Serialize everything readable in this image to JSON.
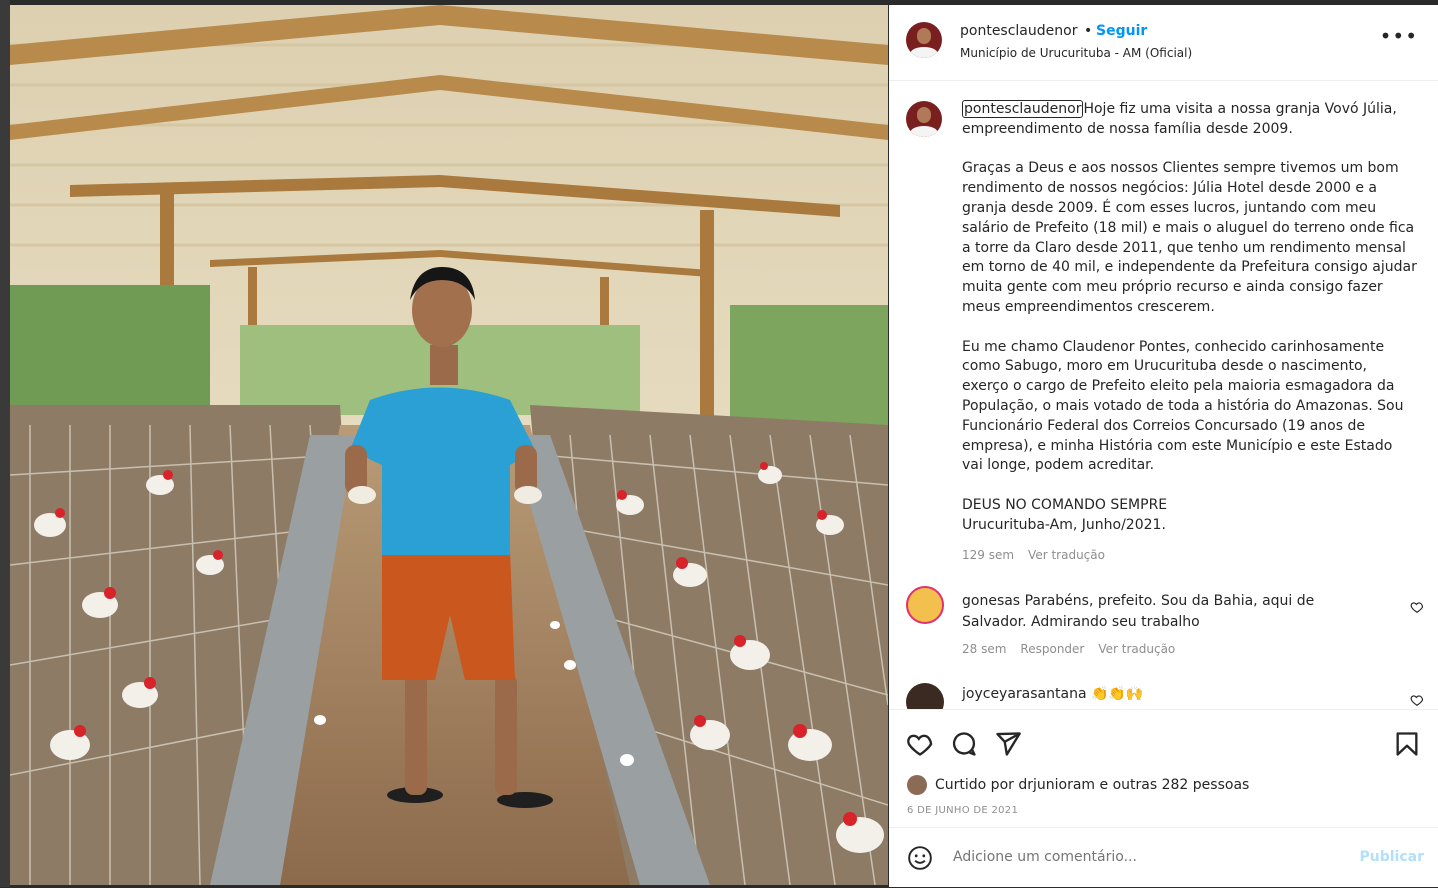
{
  "post": {
    "image_alt": "Homem de camiseta azul segurando ovos em uma granja"
  },
  "header": {
    "username": "pontesclaudenor",
    "separator": "•",
    "follow_label": "Seguir",
    "subtitle": "Município de Urucurituba - AM (Oficial)",
    "more_icon": "more-options-icon"
  },
  "caption": {
    "username": "pontesclaudenor",
    "first_line": "Hoje fiz uma visita a nossa granja Vovó Júlia, empreendimento de nossa família desde 2009.",
    "paragraph2": "Graças a Deus e aos nossos Clientes sempre tivemos um bom rendimento de nossos negócios: Júlia Hotel desde 2000 e a granja desde 2009. É com esses lucros, juntando com meu salário de Prefeito (18 mil) e mais o aluguel do terreno onde fica a torre da Claro desde 2011, que tenho um rendimento mensal em torno de 40 mil, e independente da Prefeitura consigo ajudar muita gente com meu próprio recurso e ainda consigo fazer meus empreendimentos crescerem.",
    "paragraph3": "Eu me chamo Claudenor Pontes, conhecido carinhosamente como Sabugo, moro em Urucurituba desde o nascimento, exerço o cargo de Prefeito eleito pela maioria esmagadora da População, o mais votado de toda a história do Amazonas. Sou Funcionário Federal dos Correios Concursado (19 anos de empresa), e minha História com este Município e este Estado vai longe, podem acreditar.",
    "paragraph4a": "DEUS NO COMANDO SEMPRE",
    "paragraph4b": "Urucurituba-Am, Junho/2021.",
    "time": "129 sem",
    "translate": "Ver tradução"
  },
  "comments": [
    {
      "username": "gonesas",
      "text": "Parabéns, prefeito. Sou da Bahia, aqui de Salvador. Admirando seu trabalho",
      "time": "28 sem",
      "reply": "Responder",
      "translate": "Ver tradução"
    },
    {
      "username": "joyceyarasantana",
      "text": "👏👏🙌"
    }
  ],
  "actions": {
    "like_icon": "heart-icon",
    "comment_icon": "comment-icon",
    "share_icon": "share-icon",
    "save_icon": "bookmark-icon"
  },
  "likes": {
    "prefix": "Curtido por",
    "user": "drjunioram",
    "connector": "e",
    "others": "outras 282 pessoas"
  },
  "date": "6 DE JUNHO DE 2021",
  "add_comment": {
    "placeholder": "Adicione um comentário...",
    "publish": "Publicar"
  },
  "colors": {
    "accent": "#0095f6",
    "publish_disabled": "#b2dffc",
    "muted": "#8e8e8e"
  }
}
